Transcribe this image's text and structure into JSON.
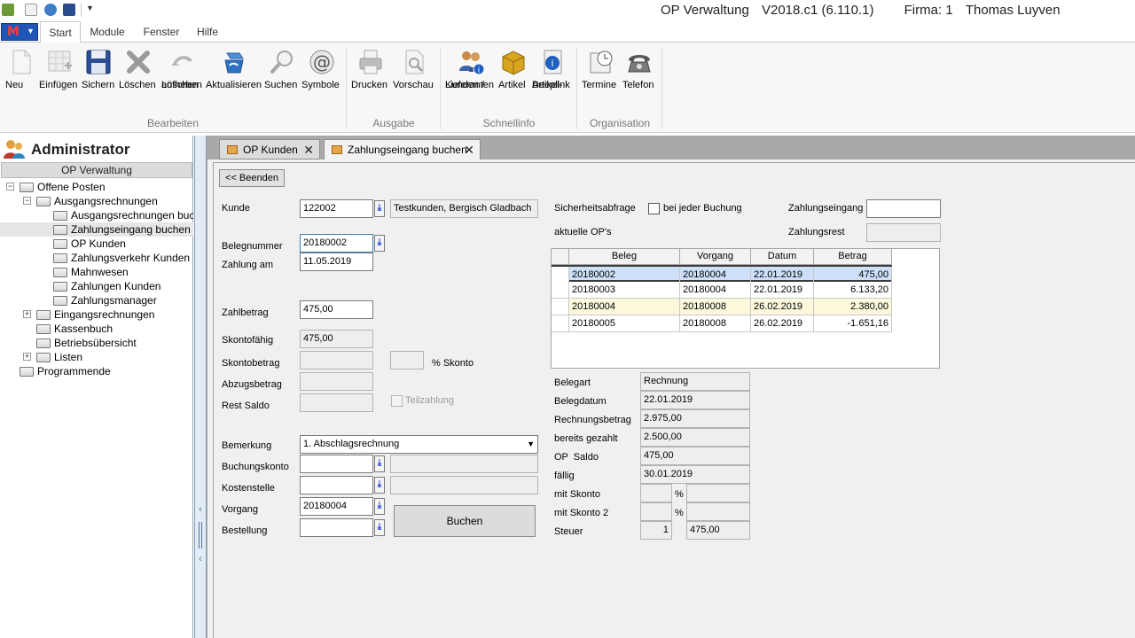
{
  "window": {
    "app": "OP Verwaltung",
    "version": "V2018.c1 (6.110.1)",
    "firma": "Firma: 1",
    "user": "Thomas Luyven"
  },
  "ribbon_tabs": [
    "Start",
    "Module",
    "Fenster",
    "Hilfe"
  ],
  "ribbon": {
    "bearbeiten": {
      "label": "Bearbeiten",
      "neu": "Neu",
      "einfuegen": "Einfügen",
      "sichern": "Sichern",
      "loeschen": "Löschen",
      "loeschen_aufheben_1": "Löschen",
      "loeschen_aufheben_2": "aufheben",
      "aktualisieren": "Aktualisieren",
      "suchen": "Suchen",
      "symbole": "Symbole"
    },
    "ausgabe": {
      "label": "Ausgabe",
      "drucken": "Drucken",
      "vorschau": "Vorschau"
    },
    "schnellinfo": {
      "label": "Schnellinfo",
      "kunden_1": "Kunden /",
      "kunden_2": "Lieferanten",
      "artikel": "Artikel",
      "deeplink_1": "Artikel-",
      "deeplink_2": "Deeplink"
    },
    "organisation": {
      "label": "Organisation",
      "termine": "Termine",
      "telefon": "Telefon"
    }
  },
  "sidebar": {
    "title": "Administrator",
    "section": "OP Verwaltung",
    "tree": {
      "offene_posten": "Offene Posten",
      "ausgangsrechnungen": "Ausgangsrechnungen",
      "ausgangsrechnungen_buchen": "Ausgangsrechnungen buchen",
      "zahlungseingang_buchen": "Zahlungseingang buchen",
      "op_kunden": "OP Kunden",
      "zahlungsverkehr_kunden": "Zahlungsverkehr Kunden",
      "mahnwesen": "Mahnwesen",
      "zahlungen_kunden": "Zahlungen Kunden",
      "zahlungsmanager": "Zahlungsmanager",
      "eingangsrechnungen": "Eingangsrechnungen",
      "kassenbuch": "Kassenbuch",
      "betriebsuebersicht": "Betriebsübersicht",
      "listen": "Listen",
      "programmende": "Programmende"
    }
  },
  "doc_tabs": [
    "OP Kunden",
    "Zahlungseingang buchen"
  ],
  "form": {
    "beenden": "<< Beenden",
    "kunde_label": "Kunde",
    "kunde_value": "122002",
    "kunde_name": "Testkunden, Bergisch Gladbach",
    "belegnummer_label": "Belegnummer",
    "belegnummer_value": "20180002",
    "zahlung_am_label": "Zahlung am",
    "zahlung_am_value": "11.05.2019",
    "zahlbetrag_label": "Zahlbetrag",
    "zahlbetrag_value": "475,00",
    "skontofaehig_label": "Skontofähig",
    "skontofaehig_value": "475,00",
    "skontobetrag_label": "Skontobetrag",
    "prozent_skonto": "% Skonto",
    "abzugsbetrag_label": "Abzugsbetrag",
    "rest_saldo_label": "Rest Saldo",
    "teilzahlung": "Teilzahlung",
    "bemerkung_label": "Bemerkung",
    "bemerkung_value": "1. Abschlagsrechnung",
    "buchungskonto_label": "Buchungskonto",
    "kostenstelle_label": "Kostenstelle",
    "vorgang_label": "Vorgang",
    "vorgang_value": "20180004",
    "bestellung_label": "Bestellung",
    "buchen": "Buchen",
    "sicherheitsabfrage": "Sicherheitsabfrage",
    "bei_jeder_buchung": "bei jeder Buchung",
    "zahlungseingang_label": "Zahlungseingang",
    "zahlungsrest_label": "Zahlungsrest",
    "aktuelle_ops": "aktuelle OP's"
  },
  "op_table": {
    "columns": [
      "Beleg",
      "Vorgang",
      "Datum",
      "Betrag"
    ],
    "rows": [
      [
        "20180002",
        "20180004",
        "22.01.2019",
        "475,00"
      ],
      [
        "20180003",
        "20180004",
        "22.01.2019",
        "6.133,20"
      ],
      [
        "20180004",
        "20180008",
        "26.02.2019",
        "2.380,00"
      ],
      [
        "20180005",
        "20180008",
        "26.02.2019",
        "-1.651,16"
      ]
    ]
  },
  "details": {
    "belegart_label": "Belegart",
    "belegart": "Rechnung",
    "belegdatum_label": "Belegdatum",
    "belegdatum": "22.01.2019",
    "rechnungsbetrag_label": "Rechnungsbetrag",
    "rechnungsbetrag": "2.975,00",
    "bereits_gezahlt_label": "bereits gezahlt",
    "bereits_gezahlt": "2.500,00",
    "op_saldo_label": "OP  Saldo",
    "op_saldo": "475,00",
    "faellig_label": "fällig",
    "faellig": "30.01.2019",
    "mit_skonto_label": "mit Skonto",
    "mit_skonto2_label": "mit Skonto 2",
    "percent": "%",
    "steuer_label": "Steuer",
    "steuer_code": "1",
    "steuer_value": "475,00"
  },
  "colors": {
    "selected_row": "#cde0f7",
    "highlight_row": "#fbf8dc",
    "app_button": "#1f55b5"
  }
}
